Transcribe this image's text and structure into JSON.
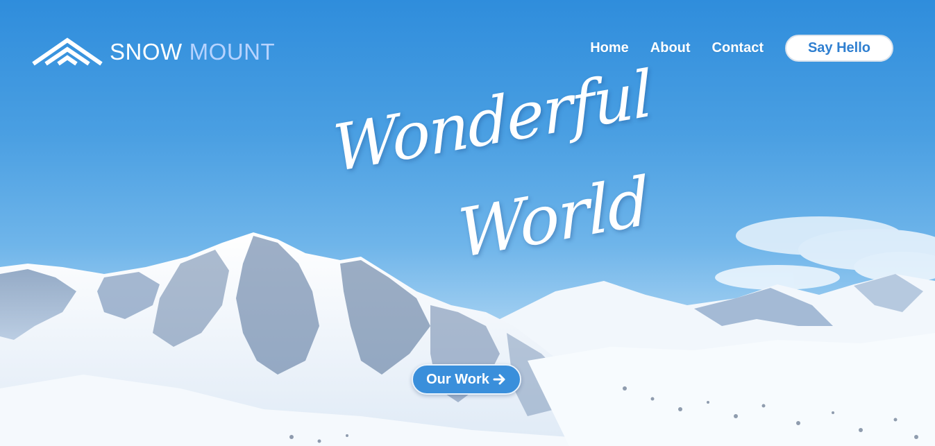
{
  "brand": {
    "word1": "SNOW",
    "word2": "MOUNT",
    "mark_icon": "triple-chevron-mountain-icon"
  },
  "nav": {
    "items": [
      {
        "label": "Home"
      },
      {
        "label": "About"
      },
      {
        "label": "Contact"
      }
    ],
    "cta_label": "Say Hello"
  },
  "hero": {
    "headline_line1": "Wonderful",
    "headline_line2": "World",
    "button_label": "Our Work",
    "button_icon": "arrow-right-icon"
  },
  "colors": {
    "sky_top": "#2f8ddc",
    "brand_accent": "#b7d3ff",
    "button_blue": "#3a8fdb",
    "cta_text": "#2f7fd0"
  }
}
